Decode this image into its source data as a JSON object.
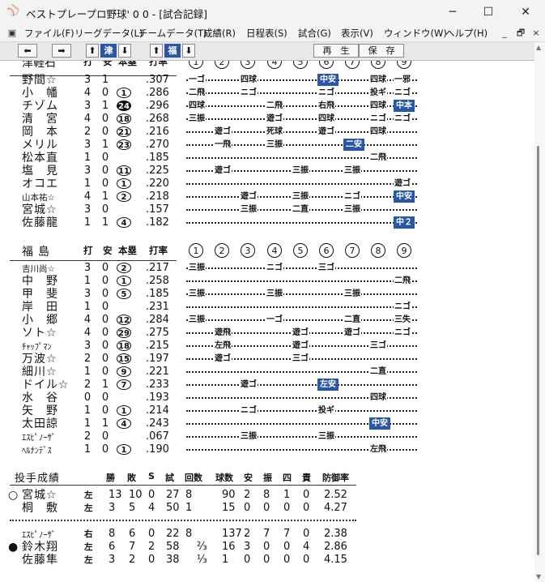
{
  "window": {
    "title": "ベストプレープロ野球' 0 0 - [試合記録]",
    "controls": [
      "─",
      "☐",
      "✕"
    ]
  },
  "menu": {
    "items": [
      "ファイル(F)",
      "リーグデータ(L)",
      "チームデータ(T)",
      "成績(R)",
      "日程表(S)",
      "試合(G)",
      "表示(V)",
      "ウィンドウ(W)",
      "ヘルプ(H)"
    ],
    "mdi_controls": [
      "_",
      "🗗",
      "×"
    ]
  },
  "toolbar": {
    "prev_arrow": "⬅",
    "next_arrow": "➡",
    "team1": "津",
    "team2": "福",
    "up_arrow": "⬆",
    "down_arrow": "⬇",
    "play_label": "再　生",
    "save_label": "保　存"
  },
  "top_team": {
    "header_name": "津軽石",
    "header_cols": [
      "打",
      "安",
      "本塁",
      "打率"
    ],
    "innings": [
      "①",
      "②",
      "③",
      "④",
      "⑤",
      "⑥",
      "⑦",
      "⑧",
      "⑨"
    ],
    "batters": [
      {
        "name": "野間☆",
        "ab": "3",
        "h": "1",
        "hr": "",
        "avg": ".307",
        "results": [
          [
            "一ゴ",
            0,
            false
          ],
          [
            "四球",
            2,
            false
          ],
          [
            "中安",
            5,
            true
          ],
          [
            "四球",
            7,
            false
          ],
          [
            "一邪",
            8,
            false
          ]
        ]
      },
      {
        "name": "小　幡",
        "ab": "4",
        "h": "0",
        "hr": "1",
        "avg": ".286",
        "results": [
          [
            "二飛",
            0,
            false
          ],
          [
            "ニゴ",
            2,
            false
          ],
          [
            "ニゴ",
            5,
            false
          ],
          [
            "投ギ",
            7,
            false
          ],
          [
            "ニゴ",
            8,
            false
          ]
        ]
      },
      {
        "name": "チゾム",
        "ab": "3",
        "h": "1",
        "hr": "24",
        "hr_black": true,
        "avg": ".296",
        "results": [
          [
            "四球",
            0,
            false
          ],
          [
            "二飛",
            3,
            false
          ],
          [
            "右飛",
            5,
            false
          ],
          [
            "四球",
            7,
            false
          ],
          [
            "中本",
            8,
            true
          ]
        ]
      },
      {
        "name": "清　宮",
        "ab": "4",
        "h": "0",
        "hr": "18",
        "avg": ".268",
        "results": [
          [
            "三振",
            0,
            false
          ],
          [
            "遊ゴ",
            3,
            false
          ],
          [
            "四球",
            5,
            false
          ],
          [
            "ニゴ",
            7,
            false
          ],
          [
            "ニゴ",
            8,
            false
          ]
        ]
      },
      {
        "name": "岡　本",
        "ab": "2",
        "h": "0",
        "hr": "21",
        "avg": ".216",
        "results": [
          [
            "遊ゴ",
            1,
            false
          ],
          [
            "死球",
            3,
            false
          ],
          [
            "遊ゴ",
            5,
            false
          ],
          [
            "四球",
            7,
            false
          ]
        ]
      },
      {
        "name": "メリル",
        "ab": "3",
        "h": "1",
        "hr": "23",
        "avg": ".270",
        "results": [
          [
            "一飛",
            1,
            false
          ],
          [
            "三振",
            3,
            false
          ],
          [
            "二安",
            6,
            true
          ]
        ]
      },
      {
        "name": "松本直",
        "ab": "1",
        "h": "0",
        "hr": "",
        "avg": ".185",
        "results": [
          [
            "二飛",
            7,
            false
          ]
        ]
      },
      {
        "name": "塩　見",
        "ab": "3",
        "h": "0",
        "hr": "11",
        "avg": ".225",
        "results": [
          [
            "遊ゴ",
            1,
            false
          ],
          [
            "三振",
            4,
            false
          ],
          [
            "三振",
            6,
            false
          ]
        ]
      },
      {
        "name": "オコエ",
        "ab": "1",
        "h": "0",
        "hr": "1",
        "avg": ".220",
        "results": [
          [
            "遊ゴ",
            8,
            false
          ]
        ]
      },
      {
        "name": "山本祐☆",
        "small": true,
        "ab": "4",
        "h": "1",
        "hr": "2",
        "avg": ".218",
        "results": [
          [
            "遊ゴ",
            2,
            false
          ],
          [
            "三振",
            4,
            false
          ],
          [
            "ニゴ",
            6,
            false
          ],
          [
            "中安",
            8,
            true
          ]
        ]
      },
      {
        "name": "宮城☆",
        "ab": "3",
        "h": "0",
        "hr": "",
        "avg": ".157",
        "results": [
          [
            "三振",
            2,
            false
          ],
          [
            "二直",
            4,
            false
          ],
          [
            "三振",
            6,
            false
          ]
        ]
      },
      {
        "name": "佐藤龍",
        "ab": "1",
        "h": "1",
        "hr": "4",
        "avg": ".182",
        "results": [
          [
            "中２",
            8,
            true
          ]
        ]
      }
    ]
  },
  "bottom_team": {
    "header_name": "福島",
    "header_cols": [
      "打",
      "安",
      "本塁",
      "打率"
    ],
    "innings": [
      "①",
      "②",
      "③",
      "④",
      "⑤",
      "⑥",
      "⑦",
      "⑧",
      "⑨"
    ],
    "batters": [
      {
        "name": "吉川尚☆",
        "small": true,
        "ab": "3",
        "h": "0",
        "hr": "2",
        "avg": ".217",
        "results": [
          [
            "三振",
            0,
            false
          ],
          [
            "ニゴ",
            3,
            false
          ],
          [
            "三ゴ",
            5,
            false
          ]
        ]
      },
      {
        "name": "中　野",
        "ab": "1",
        "h": "0",
        "hr": "1",
        "avg": ".258",
        "results": [
          [
            "二飛",
            8,
            false
          ]
        ]
      },
      {
        "name": "甲　斐",
        "ab": "3",
        "h": "0",
        "hr": "5",
        "avg": ".185",
        "results": [
          [
            "三振",
            0,
            false
          ],
          [
            "三振",
            3,
            false
          ],
          [
            "三振",
            6,
            false
          ]
        ]
      },
      {
        "name": "岸　田",
        "ab": "1",
        "h": "0",
        "hr": "",
        "avg": ".231",
        "results": [
          [
            "ニゴ",
            8,
            false
          ]
        ]
      },
      {
        "name": "小　郷",
        "ab": "4",
        "h": "0",
        "hr": "12",
        "avg": ".284",
        "results": [
          [
            "三振",
            0,
            false
          ],
          [
            "一ゴ",
            3,
            false
          ],
          [
            "二直",
            6,
            false
          ],
          [
            "三失",
            8,
            false
          ]
        ]
      },
      {
        "name": "ソト☆",
        "ab": "4",
        "h": "0",
        "hr": "29",
        "avg": ".275",
        "results": [
          [
            "遊飛",
            1,
            false
          ],
          [
            "遊ゴ",
            4,
            false
          ],
          [
            "遊ゴ",
            6,
            false
          ],
          [
            "ニゴ",
            8,
            false
          ]
        ]
      },
      {
        "name": "ﾁｬｯﾌﾟﾏﾝ",
        "small": true,
        "ab": "3",
        "h": "0",
        "hr": "18",
        "avg": ".215",
        "results": [
          [
            "左飛",
            1,
            false
          ],
          [
            "遊ゴ",
            4,
            false
          ],
          [
            "三ゴ",
            7,
            false
          ]
        ]
      },
      {
        "name": "万波☆",
        "ab": "2",
        "h": "0",
        "hr": "15",
        "avg": ".197",
        "results": [
          [
            "遊ゴ",
            1,
            false
          ],
          [
            "三ゴ",
            4,
            false
          ]
        ]
      },
      {
        "name": "細川☆",
        "ab": "1",
        "h": "0",
        "hr": "9",
        "avg": ".221",
        "results": [
          [
            "二直",
            7,
            false
          ]
        ]
      },
      {
        "name": "ドイル☆",
        "ab": "2",
        "h": "1",
        "hr": "7",
        "avg": ".233",
        "results": [
          [
            "遊ゴ",
            2,
            false
          ],
          [
            "左安",
            5,
            true
          ]
        ]
      },
      {
        "name": "水　谷",
        "ab": "0",
        "h": "0",
        "hr": "",
        "avg": ".193",
        "results": [
          [
            "四球",
            7,
            false
          ]
        ]
      },
      {
        "name": "矢　野",
        "ab": "1",
        "h": "0",
        "hr": "1",
        "avg": ".214",
        "results": [
          [
            "ニゴ",
            2,
            false
          ],
          [
            "投ギ",
            5,
            false
          ]
        ]
      },
      {
        "name": "太田諒",
        "ab": "1",
        "h": "1",
        "hr": "4",
        "avg": ".243",
        "results": [
          [
            "中安",
            7,
            true
          ]
        ]
      },
      {
        "name": "ｴｽﾋﾟﾉｰｻﾞ",
        "small": true,
        "ab": "2",
        "h": "0",
        "hr": "",
        "avg": ".067",
        "results": [
          [
            "三振",
            2,
            false
          ],
          [
            "三振",
            5,
            false
          ]
        ]
      },
      {
        "name": "ﾍﾙﾅﾝﾃﾞｽ",
        "small": true,
        "ab": "1",
        "h": "0",
        "hr": "1",
        "avg": ".190",
        "results": [
          [
            "左飛",
            7,
            false
          ]
        ]
      }
    ]
  },
  "pitching": {
    "title": "投手成績",
    "cols": [
      "勝",
      "敗",
      "S",
      "試",
      "回数",
      "球数",
      "安",
      "振",
      "四",
      "責",
      "防御率"
    ],
    "top": [
      {
        "mark": "○",
        "name": "宮城☆",
        "hand": "左",
        "w": "13",
        "l": "10",
        "s": "0",
        "g": "27",
        "ip": "8",
        "ipf": "",
        "np": "90",
        "h": "2",
        "so": "8",
        "bb": "1",
        "er": "0",
        "era": "2.52"
      },
      {
        "mark": "",
        "name": "桐　敷",
        "hand": "左",
        "w": "3",
        "l": "5",
        "s": "4",
        "g": "50",
        "ip": "1",
        "ipf": "",
        "np": "15",
        "h": "0",
        "so": "0",
        "bb": "0",
        "er": "0",
        "era": "4.27"
      }
    ],
    "bottom": [
      {
        "mark": "",
        "name": "ｴｽﾋﾟﾉｰｻﾞ",
        "small": true,
        "hand": "右",
        "w": "8",
        "l": "6",
        "s": "0",
        "g": "22",
        "ip": "8",
        "ipf": "",
        "np": "137",
        "h": "2",
        "so": "7",
        "bb": "7",
        "er": "0",
        "era": "2.38"
      },
      {
        "mark": "●",
        "name": "鈴木翔",
        "hand": "左",
        "w": "6",
        "l": "7",
        "s": "2",
        "g": "58",
        "ip": "",
        "ipf": "⅔",
        "np": "16",
        "h": "3",
        "so": "0",
        "bb": "0",
        "er": "4",
        "era": "2.86"
      },
      {
        "mark": "",
        "name": "佐藤隼",
        "hand": "左",
        "w": "3",
        "l": "2",
        "s": "0",
        "g": "38",
        "ip": "",
        "ipf": "⅓",
        "np": "1",
        "h": "0",
        "so": "0",
        "bb": "0",
        "er": "0",
        "era": "4.15"
      }
    ]
  }
}
